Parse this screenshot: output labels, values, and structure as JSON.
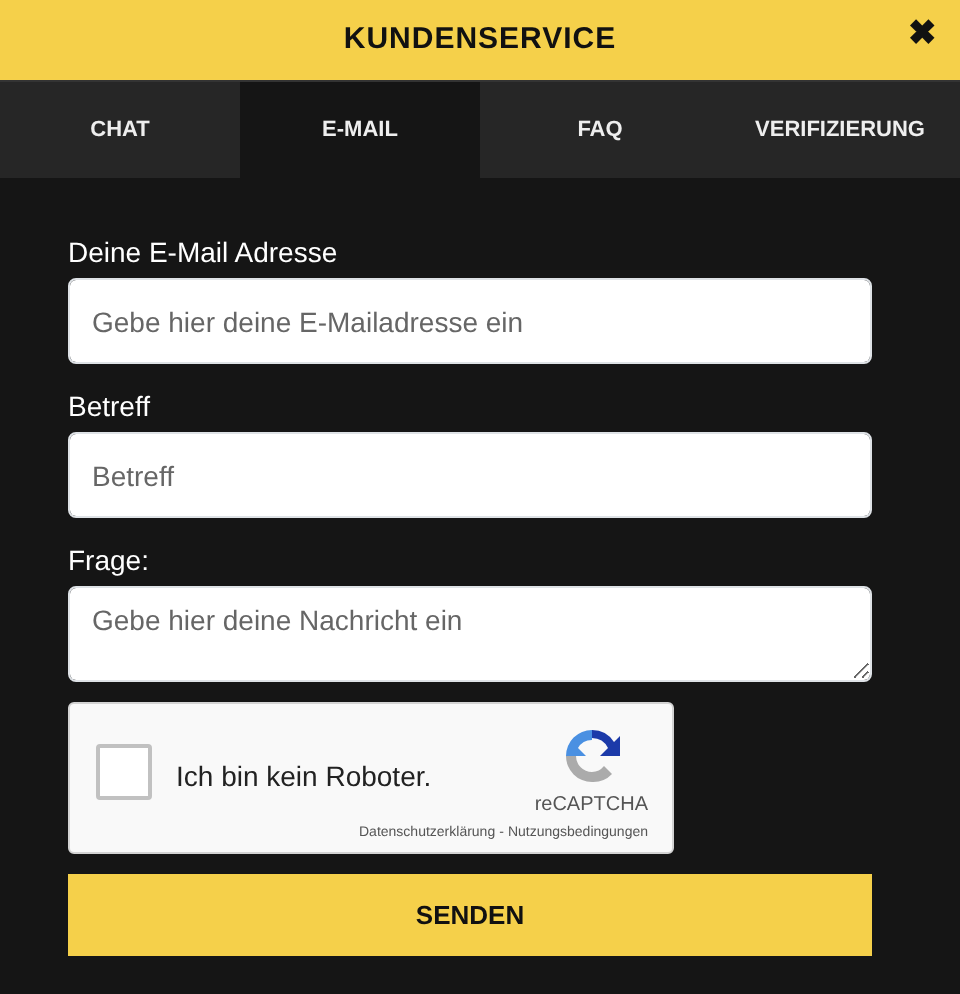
{
  "header": {
    "title": "KUNDENSERVICE",
    "close": "✖"
  },
  "tabs": [
    {
      "label": "CHAT",
      "selected": false
    },
    {
      "label": "E-MAIL",
      "selected": true
    },
    {
      "label": "FAQ",
      "selected": false
    },
    {
      "label": "VERIFIZIERUNG",
      "selected": false
    }
  ],
  "form": {
    "fields": [
      {
        "kind": "input",
        "label": "Deine E-Mail Adresse",
        "placeholder": "Gebe hier deine E-Mailadresse ein"
      },
      {
        "kind": "input",
        "label": "Betreff",
        "placeholder": "Betreff"
      },
      {
        "kind": "textarea",
        "label": "Frage:",
        "placeholder": "Gebe hier deine Nachricht ein"
      }
    ],
    "captcha": {
      "label": "Ich bin kein Roboter.",
      "checked": false,
      "brand": "reCAPTCHA",
      "privacy": "Datenschutzerklärung",
      "separator": "-",
      "terms": "Nutzungsbedingungen"
    },
    "submit": "SENDEN"
  }
}
